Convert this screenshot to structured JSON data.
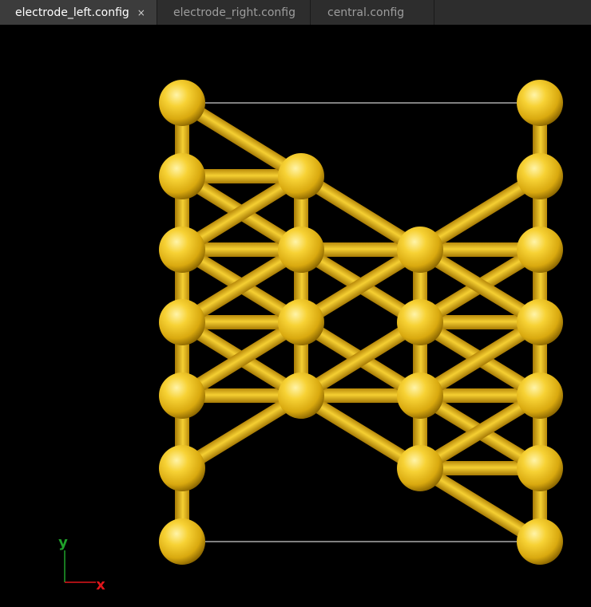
{
  "tabs": [
    {
      "label": "electrode_left.config",
      "active": true,
      "closable": true,
      "close_glyph": "×"
    },
    {
      "label": "electrode_right.config",
      "active": false
    },
    {
      "label": "central.config",
      "active": false
    }
  ],
  "viewer": {
    "background": "#000000",
    "atom_color": "#f2c21e",
    "cell_line_color": "#ffffff",
    "axes": {
      "y_label": "y",
      "x_label": "x",
      "y_color": "#1fa12a",
      "x_color": "#e0161b"
    }
  }
}
